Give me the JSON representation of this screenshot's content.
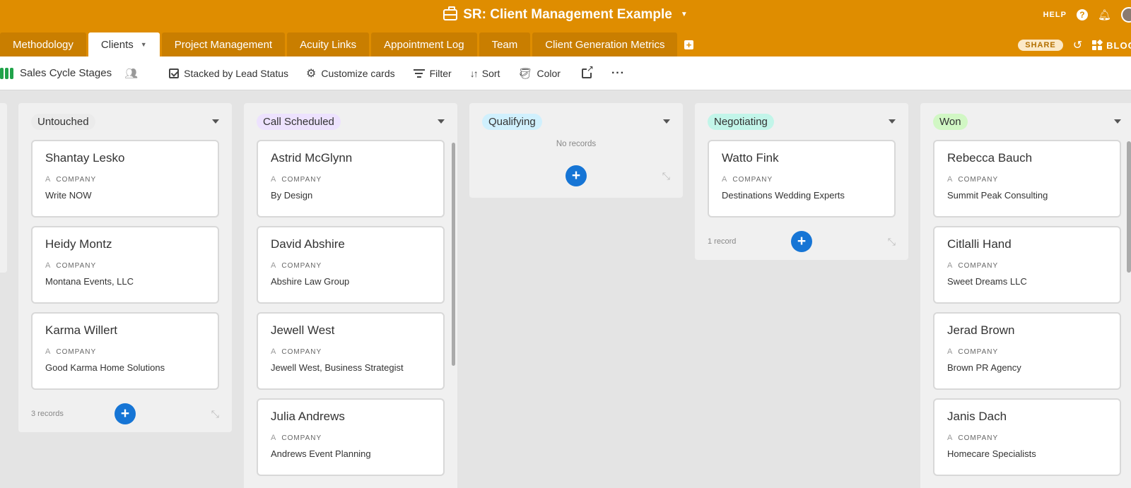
{
  "base": {
    "title": "SR: Client Management Example",
    "briefcase_icon": "briefcase-icon"
  },
  "top_right": {
    "help": "HELP"
  },
  "tabs": [
    {
      "label": "Methodology"
    },
    {
      "label": "Clients",
      "active": true
    },
    {
      "label": "Project Management"
    },
    {
      "label": "Acuity Links"
    },
    {
      "label": "Appointment Log"
    },
    {
      "label": "Team"
    },
    {
      "label": "Client Generation Metrics"
    }
  ],
  "tabs_right": {
    "share": "SHARE",
    "blocks": "BLOC"
  },
  "toolbar": {
    "view_name": "Sales Cycle Stages",
    "stacked_by": "Stacked by Lead Status",
    "customize": "Customize cards",
    "filter": "Filter",
    "sort": "Sort",
    "color": "Color"
  },
  "field_label": "COMPANY",
  "stacks": [
    {
      "name": "Untouched",
      "color": "#ebebeb",
      "footer": "3 records",
      "cards": [
        {
          "name": "Shantay Lesko",
          "company": "Write NOW"
        },
        {
          "name": "Heidy Montz",
          "company": "Montana Events, LLC"
        },
        {
          "name": "Karma Willert",
          "company": "Good Karma Home Solutions"
        }
      ]
    },
    {
      "name": "Call Scheduled",
      "color": "#ede2fe",
      "cards": [
        {
          "name": "Astrid McGlynn",
          "company": "By Design"
        },
        {
          "name": "David Abshire",
          "company": "Abshire Law Group"
        },
        {
          "name": "Jewell West",
          "company": "Jewell West, Business Strategist"
        },
        {
          "name": "Julia Andrews",
          "company": "Andrews Event Planning"
        }
      ]
    },
    {
      "name": "Qualifying",
      "color": "#d0f0fd",
      "empty": "No records",
      "cards": []
    },
    {
      "name": "Negotiating",
      "color": "#c2f5e9",
      "footer": "1 record",
      "cards": [
        {
          "name": "Watto Fink",
          "company": "Destinations Wedding Experts"
        }
      ]
    },
    {
      "name": "Won",
      "color": "#d1f7c4",
      "cards": [
        {
          "name": "Rebecca Bauch",
          "company": "Summit Peak Consulting"
        },
        {
          "name": "Citlalli Hand",
          "company": "Sweet Dreams LLC"
        },
        {
          "name": "Jerad Brown",
          "company": "Brown PR Agency"
        },
        {
          "name": "Janis Dach",
          "company": "Homecare Specialists"
        }
      ]
    }
  ],
  "add_symbol": "+",
  "colors": {
    "accent": "#df8d00",
    "add_button": "#1675d5"
  }
}
